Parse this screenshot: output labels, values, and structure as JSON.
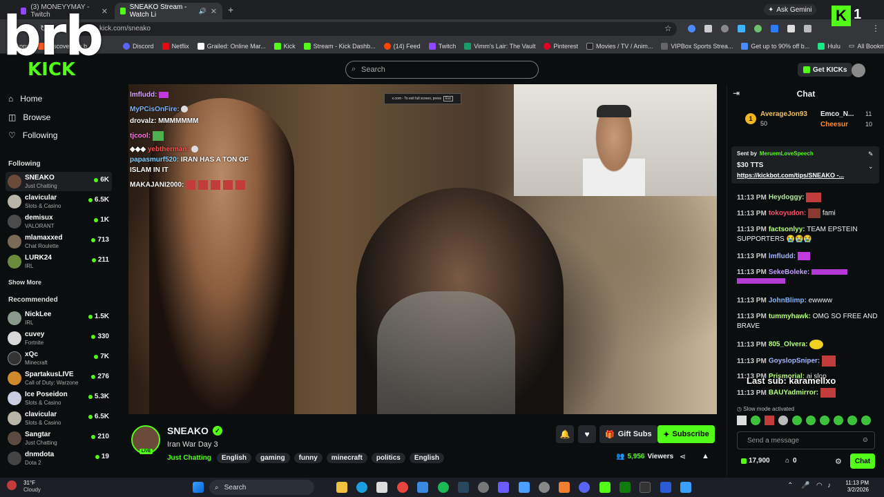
{
  "overlay": {
    "brb": "brb",
    "counter_letter": "K",
    "counter": "1"
  },
  "browser": {
    "tabs": [
      {
        "title": "(3) MONEYYMAY - Twitch",
        "active": false
      },
      {
        "title": "SNEAKO Stream - Watch Li",
        "active": true
      }
    ],
    "url": "kick.com/sneako",
    "ask_gemini": "Ask Gemini",
    "bookmarks": [
      "Apps",
      "Discover the b",
      "Discord",
      "Netflix",
      "Grailed: Online Mar...",
      "Kick",
      "Stream - Kick Dashb...",
      "(14) Feed",
      "Twitch",
      "Vimm's Lair: The Vault",
      "Pinterest",
      "Movies / TV / Anim...",
      "VIPBox Sports Strea...",
      "Get up to 90% off b...",
      "Hulu"
    ],
    "all_bookmarks": "All Bookmarks"
  },
  "header": {
    "search_placeholder": "Search",
    "get_kicks": "Get KICKs"
  },
  "sidebar": {
    "nav": [
      {
        "label": "Home",
        "icon": "home-icon"
      },
      {
        "label": "Browse",
        "icon": "browse-icon"
      },
      {
        "label": "Following",
        "icon": "heart-icon"
      }
    ],
    "following_title": "Following",
    "following": [
      {
        "name": "SNEAKO",
        "category": "Just Chatting",
        "viewers": "6K"
      },
      {
        "name": "clavicular",
        "category": "Slots & Casino",
        "viewers": "6.5K"
      },
      {
        "name": "demisux",
        "category": "VALORANT",
        "viewers": "1K"
      },
      {
        "name": "mlamaxxed",
        "category": "Chat Roulette",
        "viewers": "713"
      },
      {
        "name": "LURK24",
        "category": "IRL",
        "viewers": "211"
      }
    ],
    "show_more": "Show More",
    "recommended_title": "Recommended",
    "recommended": [
      {
        "name": "NickLee",
        "category": "IRL",
        "viewers": "1.5K"
      },
      {
        "name": "cuvey",
        "category": "Fortnite",
        "viewers": "330"
      },
      {
        "name": "xQc",
        "category": "Minecraft",
        "viewers": "7K"
      },
      {
        "name": "SpartakusLIVE",
        "category": "Call of Duty: Warzone",
        "viewers": "276"
      },
      {
        "name": "Ice Poseidon",
        "category": "Slots & Casino",
        "viewers": "5.3K"
      },
      {
        "name": "clavicular",
        "category": "Slots & Casino",
        "viewers": "6.5K"
      },
      {
        "name": "Sangtar",
        "category": "Just Chatting",
        "viewers": "210"
      },
      {
        "name": "dnmdota",
        "category": "Dota 2",
        "viewers": "19"
      }
    ]
  },
  "video_overlay": {
    "fullscreen_hint": "x.com - To exit full screen, press",
    "fullscreen_key": "Esc",
    "chat_lines": [
      {
        "user": "lmfludd:",
        "text": ""
      },
      {
        "user": "MyPCisOnFire:",
        "text": ""
      },
      {
        "user": "drovalz:",
        "text": "MMMMMMM"
      },
      {
        "user": "tjcool:",
        "text": ""
      },
      {
        "user": "yebtherman:",
        "text": ""
      },
      {
        "user": "papasmurf520:",
        "text": "IRAN HAS A TON OF"
      },
      {
        "user": "",
        "text": "ISLAM IN IT"
      },
      {
        "user": "MAKAJANI2000:",
        "text": ""
      }
    ]
  },
  "channel": {
    "name": "SNEAKO",
    "title": "Iran War Day 3",
    "live_badge": "LIVE",
    "category": "Just Chatting",
    "tags": [
      "English",
      "gaming",
      "funny",
      "minecraft",
      "politics",
      "English"
    ],
    "gift_subs": "Gift Subs",
    "subscribe": "Subscribe",
    "viewers": "5,956",
    "viewers_label": "Viewers"
  },
  "chat": {
    "title": "Chat",
    "leaderboard": [
      {
        "name": "AverageJon93",
        "amount": "50",
        "rank": "1"
      },
      {
        "name": "Emco_N...",
        "amount": "11"
      },
      {
        "name": "Cheesur",
        "amount": "10"
      }
    ],
    "pinned": {
      "sent_by_label": "Sent by",
      "sender": "MeruemLoveSpeech",
      "amount": "$30 TTS",
      "link": "https://kickbot.com/tips/SNEAKO -..."
    },
    "messages": [
      {
        "time": "11:13 PM",
        "user": "Heydoggy:",
        "color": "#b3e5a0",
        "text": ""
      },
      {
        "time": "11:13 PM",
        "user": "tokoyudon:",
        "color": "#ff4d6a",
        "text": "fami"
      },
      {
        "time": "11:13 PM",
        "user": "factsonlyy:",
        "color": "#b6ff7a",
        "text": "TEAM EPSTEIN SUPPORTERS"
      },
      {
        "time": "11:13 PM",
        "user": "lmfludd:",
        "color": "#9fb6ff",
        "text": ""
      },
      {
        "time": "11:13 PM",
        "user": "SekeBoleke:",
        "color": "#c3a0ff",
        "text": ""
      },
      {
        "time": "11:13 PM",
        "user": "JohnBlimp:",
        "color": "#7fb3ff",
        "text": "ewwww"
      },
      {
        "time": "11:13 PM",
        "user": "tummyhawk:",
        "color": "#b6ff7a",
        "text": "OMG SO FREE AND BRAVE"
      },
      {
        "time": "11:13 PM",
        "user": "805_Olvera:",
        "color": "#b6ff7a",
        "text": ""
      },
      {
        "time": "11:13 PM",
        "user": "GoyslopSniper:",
        "color": "#9fb6ff",
        "text": ""
      },
      {
        "time": "11:13 PM",
        "user": "Prismorial:",
        "color": "#b6ff7a",
        "text": "ai slop"
      },
      {
        "time": "11:13 PM",
        "user": "BAUYadmirror:",
        "color": "#b6ff7a",
        "text": ""
      }
    ],
    "last_sub": "Last sub: karamellxo",
    "slow_mode": "Slow mode activated",
    "input_placeholder": "Send a message",
    "kicks_balance": "17,900",
    "subs_count": "0",
    "chat_button": "Chat"
  },
  "taskbar": {
    "weather_temp": "31°F",
    "weather_desc": "Cloudy",
    "search": "Search",
    "time": "11:13 PM",
    "date": "3/2/2026"
  },
  "colors": {
    "kick_green": "#53fc18",
    "bg": "#0b0e0f"
  }
}
